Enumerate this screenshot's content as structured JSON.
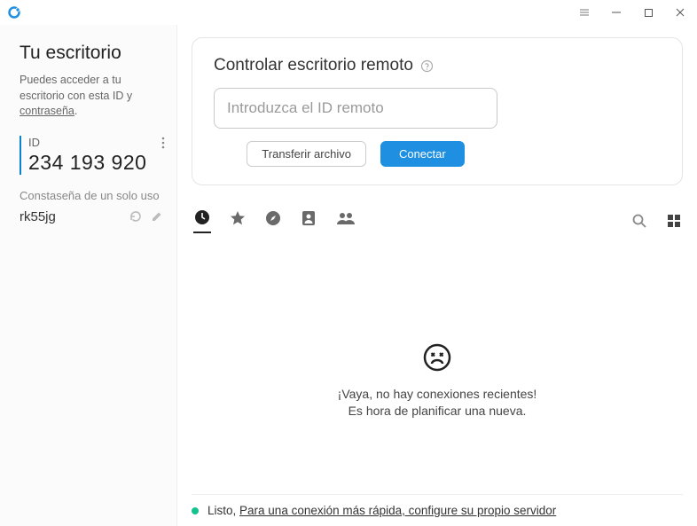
{
  "titlebar": {},
  "sidebar": {
    "title": "Tu escritorio",
    "desc_pre": "Puedes acceder a tu escritorio con esta ID y ",
    "desc_link": "contraseña",
    "desc_post": ".",
    "id_label": "ID",
    "id_value": "234 193 920",
    "pw_label": "Constaseña de un solo uso",
    "pw_value": "rk55jg"
  },
  "card": {
    "title": "Controlar escritorio remoto",
    "input_placeholder": "Introduzca el ID remoto",
    "transfer": "Transferir archivo",
    "connect": "Conectar"
  },
  "empty": {
    "line1": "¡Vaya, no hay conexiones recientes!",
    "line2": "Es hora de planificar una nueva."
  },
  "status": {
    "prefix": "Listo, ",
    "link": "Para una conexión más rápida, configure su propio servidor"
  }
}
